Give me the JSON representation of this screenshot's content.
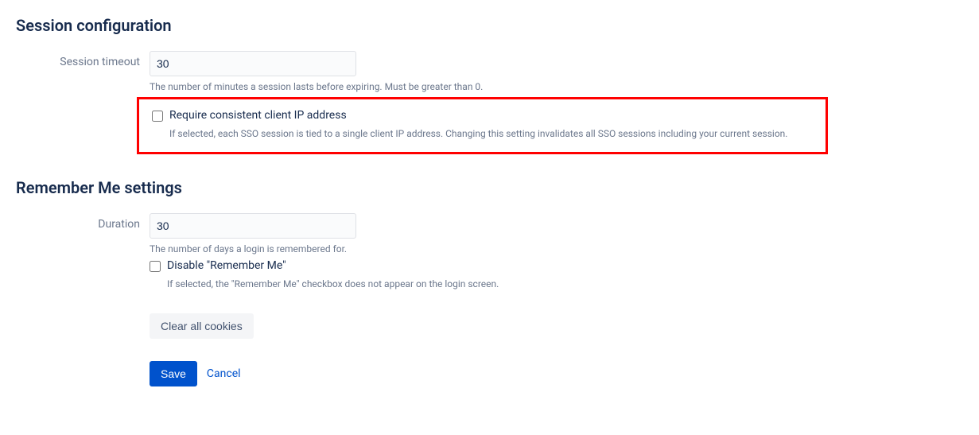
{
  "sessionConfig": {
    "heading": "Session configuration",
    "timeout": {
      "label": "Session timeout",
      "value": "30",
      "help": "The number of minutes a session lasts before expiring. Must be greater than 0."
    },
    "requireIp": {
      "label": "Require consistent client IP address",
      "help": "If selected, each SSO session is tied to a single client IP address. Changing this setting invalidates all SSO sessions including your current session."
    }
  },
  "rememberMe": {
    "heading": "Remember Me settings",
    "duration": {
      "label": "Duration",
      "value": "30",
      "help": "The number of days a login is remembered for."
    },
    "disable": {
      "label": "Disable \"Remember Me\"",
      "help": "If selected, the \"Remember Me\" checkbox does not appear on the login screen."
    },
    "clearCookies": "Clear all cookies"
  },
  "actions": {
    "save": "Save",
    "cancel": "Cancel"
  }
}
